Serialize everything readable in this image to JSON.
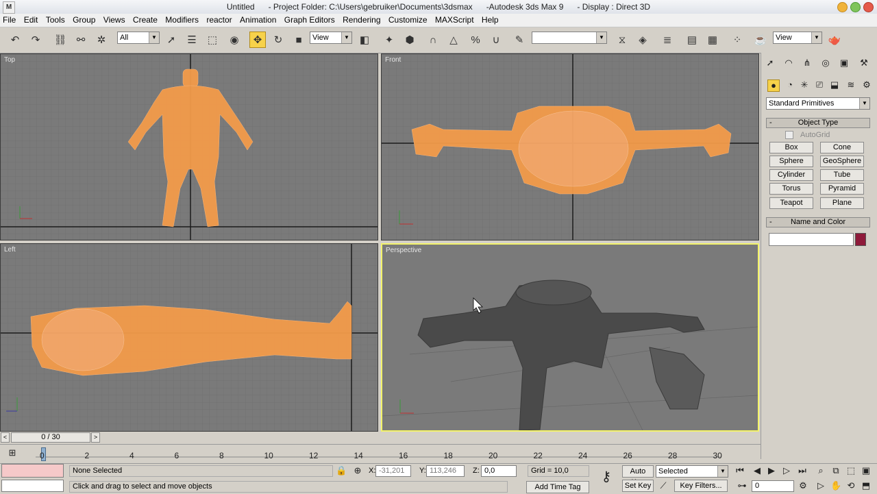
{
  "window": {
    "title": "Untitled      - Project Folder: C:\\Users\\gebruiker\\Documents\\3dsmax      -Autodesk 3ds Max 9      - Display : Direct 3D",
    "app_icon": "3ds-max-icon"
  },
  "menu": [
    "File",
    "Edit",
    "Tools",
    "Group",
    "Views",
    "Create",
    "Modifiers",
    "reactor",
    "Animation",
    "Graph Editors",
    "Rendering",
    "Customize",
    "MAXScript",
    "Help"
  ],
  "toolbar": {
    "selection_filter": "All",
    "ref_coord": "View",
    "named_selection": "",
    "view_dropdown": "View",
    "colors": {
      "active_tool": "#f7d24a"
    }
  },
  "viewports": {
    "top": {
      "label": "Top"
    },
    "front": {
      "label": "Front"
    },
    "left": {
      "label": "Left"
    },
    "perspective": {
      "label": "Perspective"
    },
    "colors": {
      "wireframe": "#f39b4a",
      "background": "#7a7a7a",
      "active_border": "#f3f36a"
    }
  },
  "command_panel": {
    "category_dropdown": "Standard Primitives",
    "object_type_title": "Object Type",
    "autogrid_label": "AutoGrid",
    "primitives": [
      "Box",
      "Cone",
      "Sphere",
      "GeoSphere",
      "Cylinder",
      "Tube",
      "Torus",
      "Pyramid",
      "Teapot",
      "Plane"
    ],
    "name_color_title": "Name and Color",
    "name_value": "",
    "object_color": "#8e1a3a"
  },
  "timeline": {
    "frame_counter": "0 / 30",
    "ticks": [
      "0",
      "2",
      "4",
      "6",
      "8",
      "10",
      "12",
      "14",
      "16",
      "18",
      "20",
      "22",
      "24",
      "26",
      "28",
      "30"
    ]
  },
  "status": {
    "selection": "None Selected",
    "prompt": "Click and drag to select and move objects",
    "x_label": "X:",
    "x_value": "-31,201",
    "y_label": "Y:",
    "y_value": "113,246",
    "z_label": "Z:",
    "z_value": "0,0",
    "grid": "Grid = 10,0",
    "add_time_tag": "Add Time Tag",
    "auto_key": "Auto Key",
    "set_key": "Set Key",
    "key_mode": "Selected",
    "key_filters": "Key Filters...",
    "current_frame": "0"
  }
}
